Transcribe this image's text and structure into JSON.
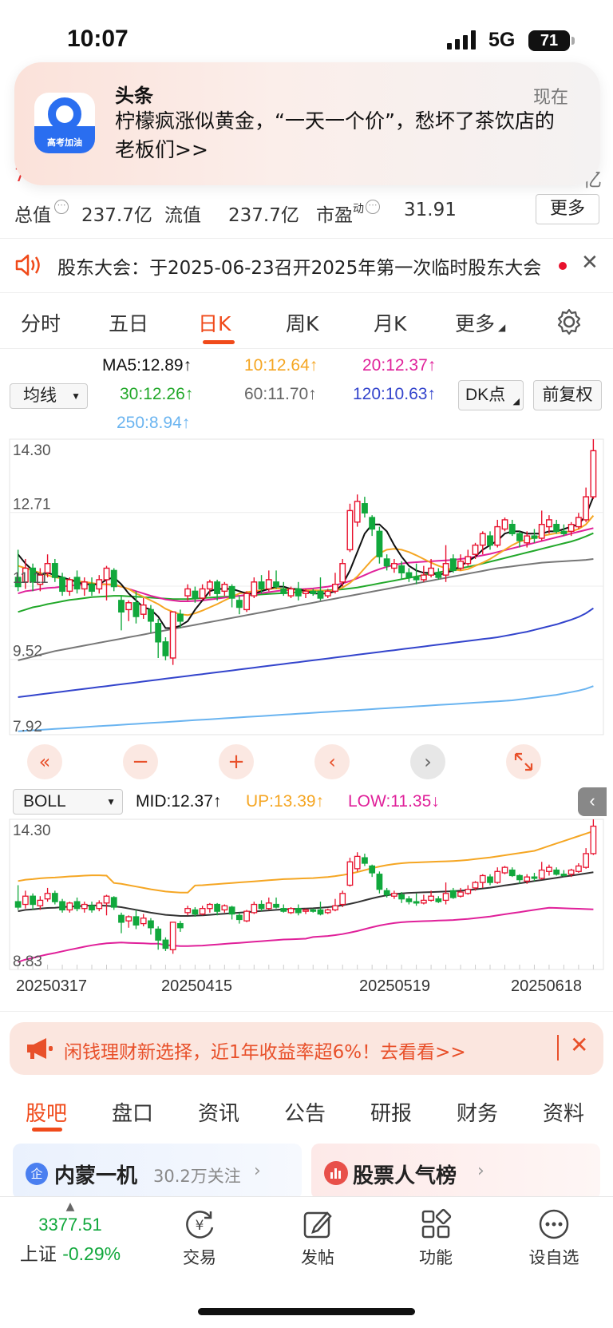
{
  "status_bar": {
    "time": "10:07",
    "network": "5G",
    "battery": "71"
  },
  "notification": {
    "app_name": "头条",
    "app_icon_label": "高考加油",
    "time": "现在",
    "message": "柠檬疯涨似黄金，“一天一个价”，愁坏了茶饮店的老板们>>"
  },
  "stock_header": {
    "partial_row_left": "7.30%  0.00",
    "partial_row_right": "亿",
    "total_value_label": "总值",
    "total_value": "237.7亿",
    "float_value_label": "流值",
    "float_value": "237.7亿",
    "pe_label": "市盈",
    "pe_sup": "动",
    "pe_value": "31.91",
    "more_label": "更多"
  },
  "notice": {
    "text": "股东大会：于2025-06-23召开2025年第一次临时股东大会"
  },
  "chart_tabs": [
    {
      "label": "分时",
      "active": false
    },
    {
      "label": "五日",
      "active": false
    },
    {
      "label": "日K",
      "active": true
    },
    {
      "label": "周K",
      "active": false
    },
    {
      "label": "月K",
      "active": false
    },
    {
      "label": "更多",
      "active": false
    }
  ],
  "legend": {
    "indicator_select": "均线",
    "dk_label": "DK点",
    "fq_label": "前复权",
    "ma5": "MA5:12.89↑",
    "ma10": "10:12.64↑",
    "ma20": "20:12.37↑",
    "ma30": "30:12.26↑",
    "ma60": "60:11.70↑",
    "ma120": "120:10.63↑",
    "ma250": "250:8.94↑"
  },
  "colors": {
    "up": "#e8112d",
    "down": "#11a83c",
    "ma5": "#111111",
    "ma10": "#f5a623",
    "ma20": "#e0219a",
    "ma30": "#22a82a",
    "ma60": "#777777",
    "ma120": "#3344cc",
    "ma250": "#6ab4f0",
    "accent": "#f04a1a"
  },
  "chart_data": [
    {
      "type": "candlestick",
      "ylim": [
        7.92,
        14.3
      ],
      "y_ticks": [
        "14.30",
        "12.71",
        "11.11",
        "9.52",
        "7.92"
      ],
      "candles": [
        [
          11.3,
          11.1,
          11.9,
          11.0
        ],
        [
          11.2,
          11.5,
          11.7,
          11.05
        ],
        [
          11.5,
          11.2,
          11.6,
          11.0
        ],
        [
          11.15,
          11.35,
          11.5,
          11.0
        ],
        [
          11.4,
          11.6,
          11.8,
          11.3
        ],
        [
          11.6,
          11.3,
          11.7,
          11.2
        ],
        [
          11.3,
          11.0,
          11.4,
          10.9
        ],
        [
          11.0,
          11.25,
          11.3,
          10.9
        ],
        [
          11.3,
          11.05,
          11.45,
          10.95
        ],
        [
          11.05,
          11.2,
          11.3,
          10.9
        ],
        [
          11.15,
          11.0,
          11.3,
          10.9
        ],
        [
          11.05,
          11.25,
          11.35,
          10.95
        ],
        [
          11.25,
          11.5,
          11.55,
          10.8
        ],
        [
          11.45,
          11.1,
          11.5,
          11.0
        ],
        [
          10.8,
          10.55,
          10.9,
          10.15
        ],
        [
          10.6,
          10.75,
          10.8,
          10.35
        ],
        [
          10.75,
          10.45,
          11.0,
          10.3
        ],
        [
          10.5,
          10.7,
          10.85,
          10.4
        ],
        [
          10.6,
          10.35,
          10.7,
          10.1
        ],
        [
          10.3,
          9.9,
          10.4,
          9.55
        ],
        [
          9.9,
          9.6,
          10.0,
          9.5
        ],
        [
          9.55,
          10.55,
          10.55,
          9.4
        ],
        [
          10.5,
          10.35,
          10.6,
          10.2
        ],
        [
          10.9,
          11.05,
          11.15,
          10.8
        ],
        [
          11.0,
          10.85,
          11.1,
          10.75
        ],
        [
          10.85,
          11.05,
          11.15,
          10.8
        ],
        [
          11.05,
          11.2,
          11.25,
          10.9
        ],
        [
          11.2,
          10.95,
          11.25,
          10.8
        ],
        [
          11.0,
          11.15,
          11.2,
          10.9
        ],
        [
          11.1,
          10.85,
          11.15,
          10.65
        ],
        [
          10.8,
          10.65,
          10.9,
          10.5
        ],
        [
          10.6,
          10.95,
          11.0,
          10.55
        ],
        [
          10.9,
          11.2,
          11.3,
          10.85
        ],
        [
          11.2,
          11.05,
          11.35,
          10.95
        ],
        [
          11.05,
          11.25,
          11.45,
          11.0
        ],
        [
          11.2,
          11.1,
          11.45,
          11.05
        ],
        [
          11.05,
          10.95,
          11.2,
          10.9
        ],
        [
          10.9,
          11.05,
          11.1,
          10.85
        ],
        [
          11.05,
          10.9,
          11.2,
          10.8
        ],
        [
          10.95,
          11.0,
          11.05,
          10.85
        ],
        [
          11.0,
          10.95,
          11.05,
          10.9
        ],
        [
          11.0,
          10.85,
          11.3,
          10.8
        ],
        [
          10.9,
          11.0,
          11.05,
          10.85
        ],
        [
          11.0,
          11.15,
          11.4,
          10.95
        ],
        [
          11.2,
          11.6,
          11.7,
          11.1
        ],
        [
          11.9,
          12.75,
          12.9,
          11.85
        ],
        [
          12.5,
          12.95,
          13.1,
          12.4
        ],
        [
          12.9,
          12.7,
          13.05,
          12.6
        ],
        [
          12.6,
          12.35,
          12.65,
          12.2
        ],
        [
          12.3,
          11.75,
          12.4,
          11.6
        ],
        [
          11.7,
          11.55,
          11.8,
          11.45
        ],
        [
          11.5,
          11.6,
          11.7,
          11.4
        ],
        [
          11.55,
          11.4,
          11.65,
          11.25
        ],
        [
          11.4,
          11.3,
          11.5,
          11.2
        ],
        [
          11.3,
          11.25,
          11.6,
          11.15
        ],
        [
          11.25,
          11.35,
          11.55,
          11.2
        ],
        [
          11.35,
          11.5,
          11.7,
          11.3
        ],
        [
          11.4,
          11.3,
          11.5,
          11.25
        ],
        [
          11.35,
          11.6,
          12.0,
          11.2
        ],
        [
          11.7,
          11.45,
          11.8,
          11.4
        ],
        [
          11.5,
          11.65,
          11.8,
          11.45
        ],
        [
          11.6,
          11.75,
          11.9,
          11.55
        ],
        [
          11.8,
          12.0,
          12.05,
          11.7
        ],
        [
          12.0,
          12.25,
          12.3,
          11.8
        ],
        [
          12.2,
          12.0,
          12.3,
          11.9
        ],
        [
          12.0,
          12.4,
          12.55,
          11.95
        ],
        [
          12.35,
          12.55,
          12.6,
          12.3
        ],
        [
          12.45,
          12.25,
          12.55,
          12.2
        ],
        [
          12.25,
          12.1,
          12.3,
          11.95
        ],
        [
          12.05,
          12.2,
          12.3,
          11.95
        ],
        [
          12.2,
          12.15,
          12.35,
          12.05
        ],
        [
          12.15,
          12.45,
          12.75,
          12.1
        ],
        [
          12.4,
          12.55,
          12.65,
          12.25
        ],
        [
          12.45,
          12.3,
          12.55,
          12.25
        ],
        [
          12.3,
          12.25,
          12.45,
          12.2
        ],
        [
          12.3,
          12.45,
          12.5,
          12.2
        ],
        [
          12.4,
          12.6,
          12.7,
          12.35
        ],
        [
          12.55,
          13.05,
          13.25,
          12.5
        ],
        [
          13.05,
          14.05,
          14.3,
          13.0
        ]
      ],
      "ma5": [
        11.8,
        11.6,
        11.45,
        11.35,
        11.4,
        11.35,
        11.3,
        11.25,
        11.2,
        11.15,
        11.15,
        11.15,
        11.25,
        11.3,
        11.15,
        10.95,
        10.8,
        10.65,
        10.6,
        10.45,
        10.2,
        10.2,
        10.25,
        10.35,
        10.6,
        10.8,
        11.0,
        11.05,
        11.05,
        11.05,
        11.0,
        10.95,
        10.95,
        11.0,
        11.05,
        11.1,
        11.1,
        11.05,
        11.05,
        11.0,
        10.95,
        10.95,
        10.95,
        11.0,
        11.15,
        11.45,
        11.85,
        12.25,
        12.45,
        12.45,
        12.3,
        12.0,
        11.75,
        11.55,
        11.45,
        11.4,
        11.4,
        11.35,
        11.4,
        11.45,
        11.55,
        11.65,
        11.75,
        11.9,
        12.0,
        12.1,
        12.25,
        12.3,
        12.3,
        12.25,
        12.25,
        12.25,
        12.3,
        12.3,
        12.35,
        12.4,
        12.45,
        12.65,
        13.05
      ],
      "ma10": [
        11.55,
        11.5,
        11.45,
        11.4,
        11.35,
        11.3,
        11.28,
        11.25,
        11.22,
        11.2,
        11.18,
        11.15,
        11.15,
        11.15,
        11.1,
        11.05,
        10.95,
        10.88,
        10.8,
        10.72,
        10.62,
        10.55,
        10.5,
        10.48,
        10.52,
        10.58,
        10.65,
        10.72,
        10.8,
        10.88,
        10.95,
        10.98,
        11.0,
        11.02,
        11.05,
        11.06,
        11.05,
        11.04,
        11.03,
        11.02,
        11.02,
        11.02,
        11.0,
        11.02,
        11.08,
        11.18,
        11.32,
        11.5,
        11.68,
        11.82,
        11.9,
        11.92,
        11.9,
        11.85,
        11.78,
        11.7,
        11.62,
        11.55,
        11.5,
        11.47,
        11.45,
        11.48,
        11.55,
        11.62,
        11.7,
        11.8,
        11.9,
        12.0,
        12.08,
        12.12,
        12.16,
        12.2,
        12.23,
        12.26,
        12.28,
        12.3,
        12.35,
        12.45,
        12.64
      ],
      "ma20": [
        10.95,
        11.0,
        11.02,
        11.05,
        11.07,
        11.08,
        11.1,
        11.12,
        11.13,
        11.15,
        11.16,
        11.16,
        11.15,
        11.13,
        11.1,
        11.05,
        11.0,
        10.95,
        10.9,
        10.86,
        10.82,
        10.8,
        10.78,
        10.78,
        10.79,
        10.8,
        10.82,
        10.84,
        10.86,
        10.88,
        10.9,
        10.92,
        10.94,
        10.96,
        10.98,
        11.0,
        11.02,
        11.03,
        11.04,
        11.05,
        11.06,
        11.08,
        11.1,
        11.13,
        11.17,
        11.22,
        11.28,
        11.35,
        11.42,
        11.48,
        11.53,
        11.57,
        11.6,
        11.62,
        11.63,
        11.64,
        11.65,
        11.66,
        11.67,
        11.68,
        11.7,
        11.72,
        11.75,
        11.78,
        11.81,
        11.85,
        11.89,
        11.93,
        11.97,
        12.01,
        12.05,
        12.09,
        12.13,
        12.17,
        12.21,
        12.25,
        12.29,
        12.33,
        12.37
      ],
      "ma30": [
        10.55,
        10.6,
        10.65,
        10.68,
        10.72,
        10.75,
        10.78,
        10.81,
        10.83,
        10.85,
        10.87,
        10.88,
        10.89,
        10.9,
        10.9,
        10.89,
        10.88,
        10.87,
        10.86,
        10.85,
        10.84,
        10.83,
        10.83,
        10.83,
        10.84,
        10.85,
        10.86,
        10.87,
        10.88,
        10.89,
        10.9,
        10.91,
        10.92,
        10.93,
        10.94,
        10.95,
        10.96,
        10.97,
        10.98,
        10.99,
        11.0,
        11.01,
        11.02,
        11.03,
        11.04,
        11.06,
        11.08,
        11.11,
        11.14,
        11.17,
        11.2,
        11.23,
        11.26,
        11.29,
        11.32,
        11.35,
        11.38,
        11.41,
        11.44,
        11.47,
        11.5,
        11.53,
        11.56,
        11.6,
        11.64,
        11.68,
        11.72,
        11.76,
        11.8,
        11.84,
        11.88,
        11.92,
        11.96,
        12.0,
        12.04,
        12.08,
        12.13,
        12.19,
        12.26
      ],
      "ma60": [
        9.5,
        9.54,
        9.58,
        9.62,
        9.66,
        9.7,
        9.73,
        9.76,
        9.79,
        9.82,
        9.85,
        9.88,
        9.91,
        9.94,
        9.97,
        10.0,
        10.03,
        10.06,
        10.09,
        10.12,
        10.15,
        10.18,
        10.21,
        10.24,
        10.27,
        10.3,
        10.33,
        10.36,
        10.39,
        10.42,
        10.45,
        10.48,
        10.51,
        10.54,
        10.57,
        10.6,
        10.63,
        10.66,
        10.69,
        10.72,
        10.75,
        10.78,
        10.81,
        10.84,
        10.87,
        10.9,
        10.93,
        10.96,
        10.99,
        11.02,
        11.05,
        11.08,
        11.11,
        11.14,
        11.17,
        11.2,
        11.23,
        11.26,
        11.29,
        11.32,
        11.35,
        11.38,
        11.41,
        11.44,
        11.47,
        11.5,
        11.52,
        11.54,
        11.56,
        11.58,
        11.6,
        11.62,
        11.63,
        11.64,
        11.65,
        11.66,
        11.67,
        11.68,
        11.7
      ],
      "ma120": [
        8.7,
        8.72,
        8.74,
        8.76,
        8.78,
        8.8,
        8.82,
        8.84,
        8.86,
        8.88,
        8.9,
        8.92,
        8.94,
        8.96,
        8.98,
        9.0,
        9.02,
        9.04,
        9.06,
        9.08,
        9.1,
        9.12,
        9.14,
        9.16,
        9.18,
        9.2,
        9.22,
        9.24,
        9.26,
        9.28,
        9.3,
        9.32,
        9.34,
        9.36,
        9.38,
        9.4,
        9.42,
        9.44,
        9.46,
        9.48,
        9.5,
        9.52,
        9.54,
        9.56,
        9.58,
        9.6,
        9.62,
        9.64,
        9.66,
        9.68,
        9.7,
        9.72,
        9.74,
        9.76,
        9.78,
        9.8,
        9.82,
        9.84,
        9.86,
        9.88,
        9.9,
        9.92,
        9.94,
        9.96,
        9.98,
        10.0,
        10.03,
        10.06,
        10.09,
        10.12,
        10.16,
        10.2,
        10.24,
        10.28,
        10.33,
        10.38,
        10.44,
        10.52,
        10.63
      ],
      "ma250": [
        7.96,
        7.97,
        7.98,
        7.99,
        8.0,
        8.01,
        8.02,
        8.03,
        8.04,
        8.05,
        8.06,
        8.07,
        8.08,
        8.09,
        8.1,
        8.11,
        8.12,
        8.13,
        8.14,
        8.15,
        8.16,
        8.17,
        8.18,
        8.19,
        8.2,
        8.21,
        8.22,
        8.23,
        8.24,
        8.25,
        8.26,
        8.27,
        8.28,
        8.29,
        8.3,
        8.31,
        8.32,
        8.33,
        8.34,
        8.35,
        8.36,
        8.37,
        8.38,
        8.39,
        8.4,
        8.41,
        8.42,
        8.43,
        8.44,
        8.45,
        8.46,
        8.47,
        8.48,
        8.49,
        8.5,
        8.51,
        8.52,
        8.53,
        8.54,
        8.55,
        8.56,
        8.57,
        8.58,
        8.59,
        8.6,
        8.61,
        8.62,
        8.63,
        8.65,
        8.67,
        8.69,
        8.71,
        8.73,
        8.75,
        8.78,
        8.81,
        8.84,
        8.88,
        8.94
      ]
    },
    {
      "type": "boll",
      "ylim": [
        8.83,
        14.3
      ],
      "y_ticks": [
        "14.30",
        "8.83"
      ],
      "indicator_select": "BOLL",
      "mid": "MID:12.37↑",
      "up": "UP:13.39↑",
      "low": "LOW:11.35↓",
      "x_ticks": [
        "20250317",
        "20250415",
        "20250519",
        "20250618"
      ]
    }
  ],
  "promo": {
    "text": "闲钱理财新选择，近1年收益率超6%！去看看>>"
  },
  "bottom_tabs": [
    {
      "label": "股吧",
      "active": true
    },
    {
      "label": "盘口",
      "active": false
    },
    {
      "label": "资讯",
      "active": false
    },
    {
      "label": "公告",
      "active": false
    },
    {
      "label": "研报",
      "active": false
    },
    {
      "label": "财务",
      "active": false
    },
    {
      "label": "资料",
      "active": false
    }
  ],
  "cards": {
    "stock_name": "内蒙一机",
    "followers": "30.2万关注",
    "badge": "企",
    "ranking": "股票人气榜"
  },
  "bottom_nav": {
    "index_value": "3377.51",
    "index_name": "上证",
    "index_change": "-0.29%",
    "trade": "交易",
    "post": "发帖",
    "function": "功能",
    "watchlist": "设自选"
  }
}
